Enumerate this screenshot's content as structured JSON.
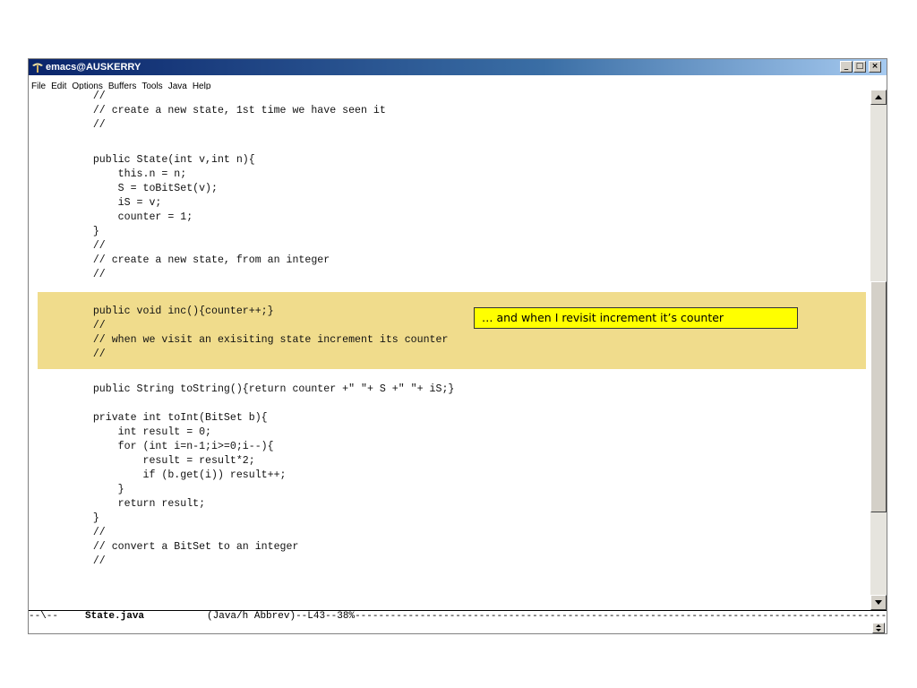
{
  "window": {
    "title": "emacs@AUSKERRY",
    "buttons": {
      "minimize": "_",
      "maximize": "□",
      "close": "×"
    }
  },
  "menu": [
    "File",
    "Edit",
    "Options",
    "Buffers",
    "Tools",
    "Java",
    "Help"
  ],
  "code_lines": [
    "    //",
    "    // create a new state, 1st time we have seen it",
    "    //",
    "",
    "    public State(int v,int n){",
    "        this.n = n;",
    "        S = toBitSet(v);",
    "        iS = v;",
    "        counter = 1;",
    "    }",
    "    //",
    "    // create a new state, from an integer",
    "    //",
    "",
    "    public void inc(){counter++;}",
    "    //",
    "    // when we visit an exisiting state increment its counter",
    "    //",
    "",
    "    public String toString(){return counter +\" \"+ S +\" \"+ iS;}",
    "",
    "    private int toInt(BitSet b){",
    "        int result = 0;",
    "        for (int i=n-1;i>=0;i--){",
    "            result = result*2;",
    "            if (b.get(i)) result++;",
    "        }",
    "        return result;",
    "    }",
    "    //",
    "    // convert a BitSet to an integer",
    "    //"
  ],
  "callout": "… and when I revisit increment it’s counter",
  "modeline": {
    "status": "--\\--",
    "buffer": "State.java",
    "mode": "(Java/h Abbrev)",
    "position": "--L43--38%--"
  },
  "colors": {
    "highlight": "#f0dc8c",
    "callout_bg": "#ffff00",
    "titlebar": "#0a246a"
  }
}
